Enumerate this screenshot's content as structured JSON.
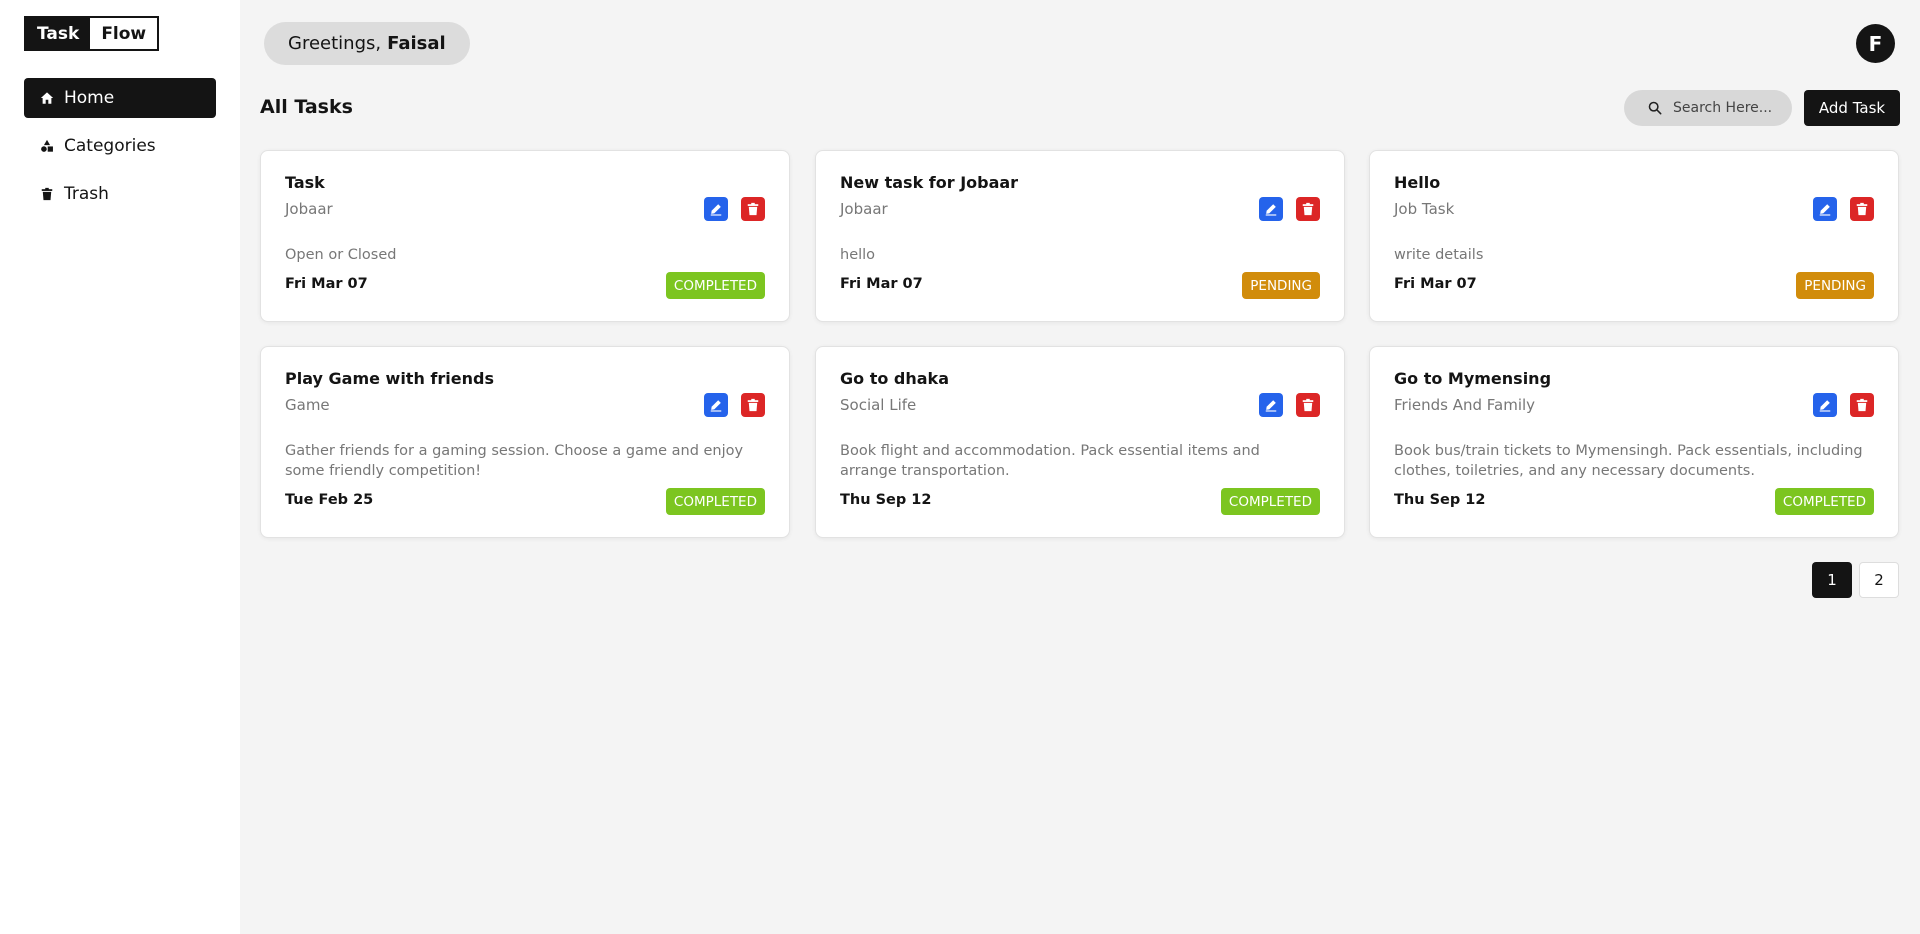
{
  "logo": {
    "part1": "Task",
    "part2": "Flow"
  },
  "sidebar": {
    "items": [
      {
        "label": "Home",
        "icon": "home-icon",
        "active": true
      },
      {
        "label": "Categories",
        "icon": "shapes-icon",
        "active": false
      },
      {
        "label": "Trash",
        "icon": "trash-icon",
        "active": false
      }
    ]
  },
  "header": {
    "greeting": "Greetings,",
    "user_name": "Faisal",
    "avatar_initial": "F"
  },
  "main": {
    "title": "All Tasks",
    "search_placeholder": "Search Here...",
    "add_task_label": "Add Task"
  },
  "tasks": [
    {
      "title": "Task",
      "category": "Jobaar",
      "description": "Open or Closed",
      "date": "Fri Mar 07",
      "status": "COMPLETED"
    },
    {
      "title": "New task for Jobaar",
      "category": "Jobaar",
      "description": "hello",
      "date": "Fri Mar 07",
      "status": "PENDING"
    },
    {
      "title": "Hello",
      "category": "Job Task",
      "description": "write details",
      "date": "Fri Mar 07",
      "status": "PENDING"
    },
    {
      "title": "Play Game with friends",
      "category": "Game",
      "description": "Gather friends for a gaming session. Choose a game and enjoy some friendly competition!",
      "date": "Tue Feb 25",
      "status": "COMPLETED"
    },
    {
      "title": "Go to dhaka",
      "category": "Social Life",
      "description": "Book flight and accommodation. Pack essential items and arrange transportation.",
      "date": "Thu Sep 12",
      "status": "COMPLETED"
    },
    {
      "title": "Go to Mymensing",
      "category": "Friends And Family",
      "description": "Book bus/train tickets to Mymensingh. Pack essentials, including clothes, toiletries, and any necessary documents.",
      "date": "Thu Sep 12",
      "status": "COMPLETED"
    }
  ],
  "pagination": {
    "pages": [
      "1",
      "2"
    ],
    "current": "1"
  },
  "colors": {
    "primary": "#141414",
    "edit": "#2563eb",
    "delete": "#dc2626",
    "completed": "#7cc520",
    "pending": "#d18c0b"
  }
}
